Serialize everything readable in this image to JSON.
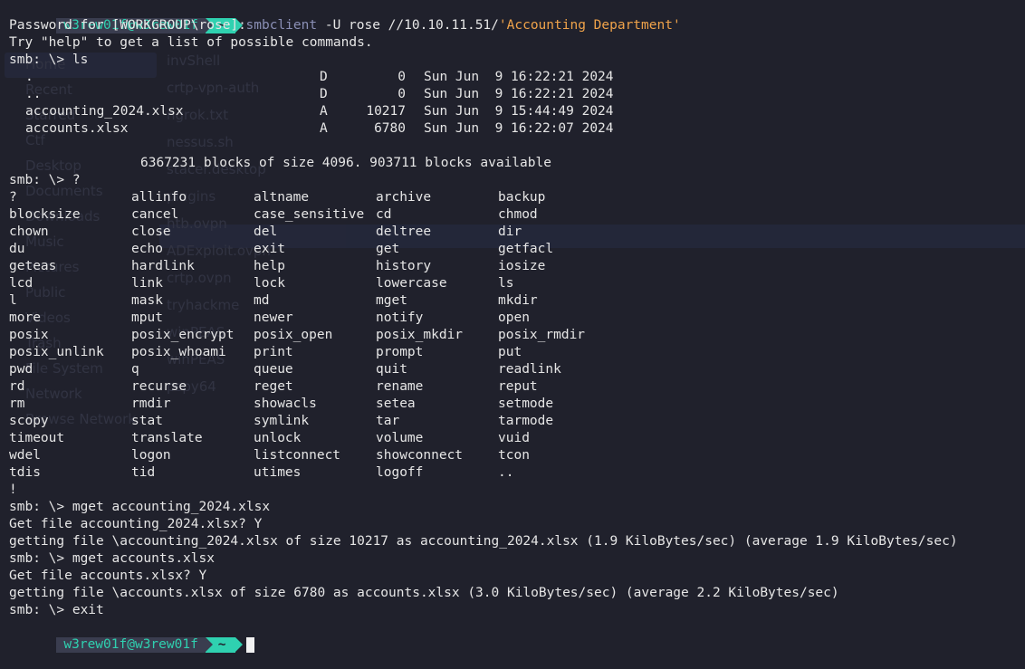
{
  "theme": {
    "background": "#20212c",
    "prompt_accent": "#2fd1b0",
    "prompt_user_bg": "#3a3d4f",
    "string_color": "#f0a34a",
    "command_color": "#8a8fb5",
    "text_color": "#e6e6e6"
  },
  "background_file_manager": {
    "sidebar": [
      "Home",
      "Recent",
      "Starred",
      "Ctf",
      "Desktop",
      "Documents",
      "Downloads",
      "Music",
      "Pictures",
      "Public",
      "Videos",
      "Trash",
      "File System",
      "Network",
      "Browse Network"
    ],
    "files": [
      "invShell",
      "crtp-vpn-auth",
      "ngrok.txt",
      "nessus.sh",
      "stacer.desktop",
      "plugins",
      "htb.ovpn",
      "ADExploit.ovpn",
      "crtp.ovpn",
      "tryhackme",
      "winPEAS",
      "winPEAS",
      "pspy64"
    ]
  },
  "prompt": {
    "user_host": "w3rew01f@w3rew01f",
    "dir": "~"
  },
  "first_command": {
    "program": "smbclient",
    "args": " -U rose //10.10.11.51/",
    "share": "'Accounting Department'"
  },
  "lines": {
    "l1": "Password for [WORKGROUP\\rose]:",
    "l2": "Try \"help\" to get a list of possible commands.",
    "l3": "smb: \\> ls",
    "l4": "6367231 blocks of size 4096. 903711 blocks available",
    "l5": "smb: \\> ?",
    "l6": "!",
    "l7": "smb: \\> mget accounting_2024.xlsx",
    "l8": "Get file accounting_2024.xlsx? Y",
    "l9": "getting file \\accounting_2024.xlsx of size 10217 as accounting_2024.xlsx (1.9 KiloBytes/sec) (average 1.9 KiloBytes/sec)",
    "l10": "smb: \\> mget accounts.xlsx",
    "l11": "Get file accounts.xlsx? Y",
    "l12": "getting file \\accounts.xlsx of size 6780 as accounts.xlsx (3.0 KiloBytes/sec) (average 2.2 KiloBytes/sec)",
    "l13": "smb: \\> exit"
  },
  "listing": [
    {
      "name": ".",
      "attr": "D",
      "size": "0",
      "date": "Sun Jun  9 16:22:21 2024"
    },
    {
      "name": "..",
      "attr": "D",
      "size": "0",
      "date": "Sun Jun  9 16:22:21 2024"
    },
    {
      "name": "accounting_2024.xlsx",
      "attr": "A",
      "size": "10217",
      "date": "Sun Jun  9 15:44:49 2024"
    },
    {
      "name": "accounts.xlsx",
      "attr": "A",
      "size": "6780",
      "date": "Sun Jun  9 16:22:07 2024"
    }
  ],
  "help_rows": [
    [
      "?",
      "allinfo",
      "altname",
      "archive",
      "backup"
    ],
    [
      "blocksize",
      "cancel",
      "case_sensitive",
      "cd",
      "chmod"
    ],
    [
      "chown",
      "close",
      "del",
      "deltree",
      "dir"
    ],
    [
      "du",
      "echo",
      "exit",
      "get",
      "getfacl"
    ],
    [
      "geteas",
      "hardlink",
      "help",
      "history",
      "iosize"
    ],
    [
      "lcd",
      "link",
      "lock",
      "lowercase",
      "ls"
    ],
    [
      "l",
      "mask",
      "md",
      "mget",
      "mkdir"
    ],
    [
      "more",
      "mput",
      "newer",
      "notify",
      "open"
    ],
    [
      "posix",
      "posix_encrypt",
      "posix_open",
      "posix_mkdir",
      "posix_rmdir"
    ],
    [
      "posix_unlink",
      "posix_whoami",
      "print",
      "prompt",
      "put"
    ],
    [
      "pwd",
      "q",
      "queue",
      "quit",
      "readlink"
    ],
    [
      "rd",
      "recurse",
      "reget",
      "rename",
      "reput"
    ],
    [
      "rm",
      "rmdir",
      "showacls",
      "setea",
      "setmode"
    ],
    [
      "scopy",
      "stat",
      "symlink",
      "tar",
      "tarmode"
    ],
    [
      "timeout",
      "translate",
      "unlock",
      "volume",
      "vuid"
    ],
    [
      "wdel",
      "logon",
      "listconnect",
      "showconnect",
      "tcon"
    ],
    [
      "tdis",
      "tid",
      "utimes",
      "logoff",
      ".."
    ]
  ]
}
